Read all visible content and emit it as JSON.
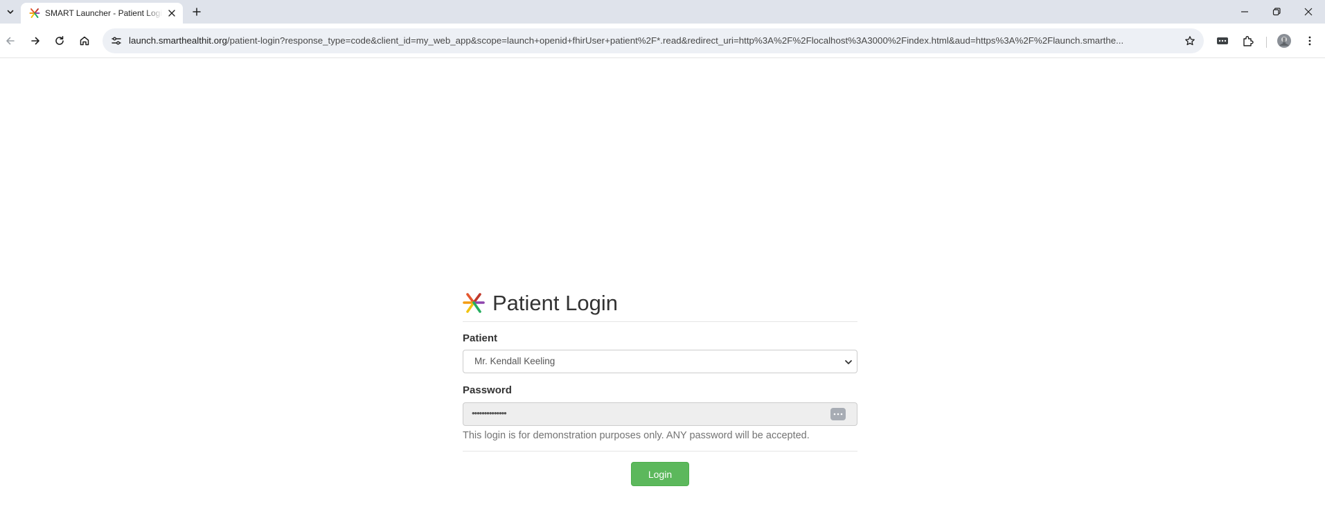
{
  "browser": {
    "tab": {
      "title": "SMART Launcher - Patient Login",
      "favicon": "smart-logo-icon",
      "close_icon": "close-icon"
    },
    "new_tab_icon": "plus-icon",
    "tab_search_icon": "chevron-down-icon",
    "window_controls": [
      "minimize-icon",
      "restore-icon",
      "close-icon"
    ],
    "nav": {
      "back_icon": "arrow-left-icon",
      "forward_icon": "arrow-right-icon",
      "reload_icon": "reload-icon",
      "home_icon": "home-icon"
    },
    "url": {
      "host": "launch.smarthealthit.org",
      "path": "/patient-login?response_type=code&client_id=my_web_app&scope=launch+openid+fhirUser+patient%2F*.read&redirect_uri=http%3A%2F%2Flocalhost%3A3000%2Findex.html&aud=https%3A%2F%2Flaunch.smarthe..."
    },
    "toolbar_icons": [
      "star-icon",
      "password-manager-icon",
      "extensions-icon",
      "profile-avatar-icon",
      "kebab-menu-icon"
    ]
  },
  "login": {
    "title": "Patient Login",
    "patient_label": "Patient",
    "patient_selected": "Mr. Kendall Keeling",
    "password_label": "Password",
    "password_value": "••••••••••••••",
    "help_text": "This login is for demonstration purposes only. ANY password will be accepted.",
    "submit_label": "Login"
  },
  "colors": {
    "login_button": "#5cb85c",
    "tabstrip": "#dfe3eb",
    "omnibox": "#edf0f5"
  }
}
